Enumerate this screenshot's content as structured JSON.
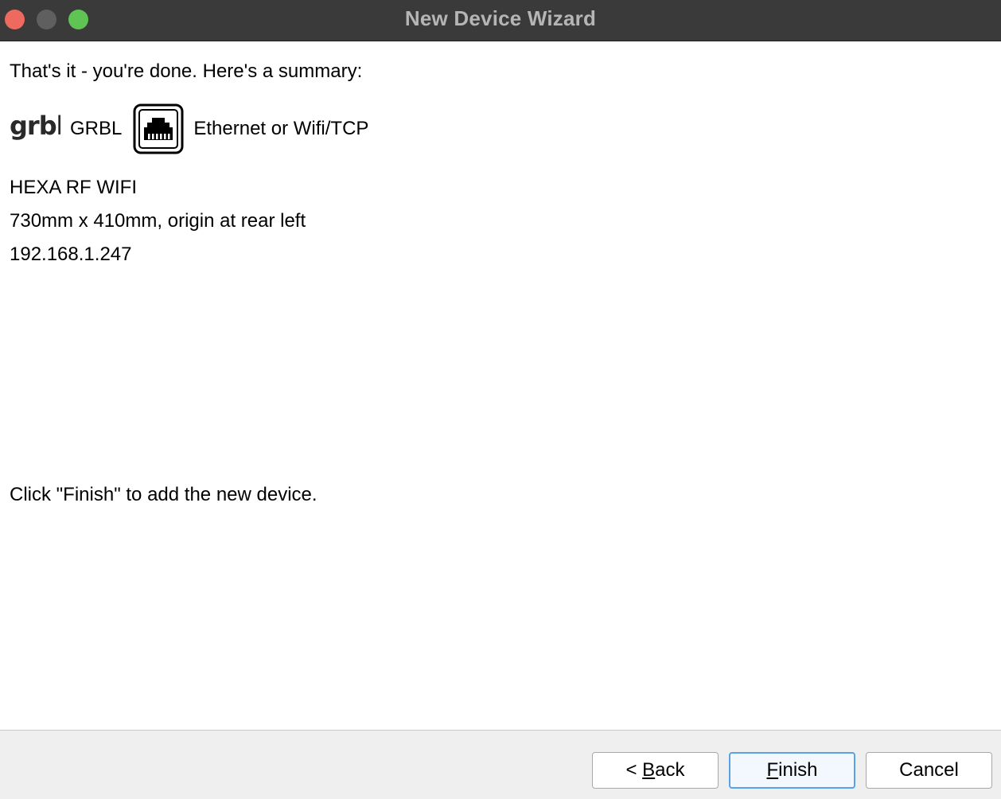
{
  "window": {
    "title": "New Device Wizard"
  },
  "summary": {
    "intro": "That's it - you're done.  Here's a summary:",
    "device_type": "GRBL",
    "connection_type": "Ethernet or Wifi/TCP",
    "device_name": "HEXA RF WIFI",
    "bed_size": "730mm x 410mm, origin at rear left",
    "address": "192.168.1.247",
    "finish_hint": "Click \"Finish\" to add the new device."
  },
  "logo": {
    "grbl_text": "grbl"
  },
  "buttons": {
    "back": {
      "prefix": "< ",
      "mnemonic": "B",
      "rest": "ack"
    },
    "finish": {
      "prefix": "",
      "mnemonic": "F",
      "rest": "inish"
    },
    "cancel": {
      "label": "Cancel"
    }
  },
  "colors": {
    "titlebar": "#3a3a3a",
    "close": "#ee6a5f",
    "minimize": "#5f5f5f",
    "maximize": "#5fc454",
    "default_button_border": "#5aa2e8"
  },
  "icons": {
    "device_logo": "grbl-logo-icon",
    "connection": "ethernet-port-icon"
  }
}
